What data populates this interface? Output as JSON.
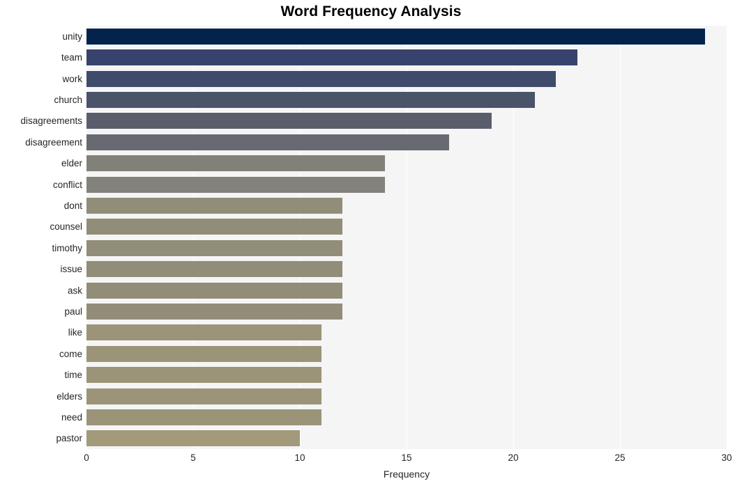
{
  "chart_data": {
    "type": "bar",
    "orientation": "horizontal",
    "title": "Word Frequency Analysis",
    "xlabel": "Frequency",
    "ylabel": "",
    "xlim": [
      0,
      30
    ],
    "xticks": [
      0,
      5,
      10,
      15,
      20,
      25,
      30
    ],
    "xtick_labels": [
      "0",
      "5",
      "10",
      "15",
      "20",
      "25",
      "30"
    ],
    "grid": "vertical-white-on-light-gray",
    "legend": "none",
    "categories": [
      "unity",
      "team",
      "work",
      "church",
      "disagreements",
      "disagreement",
      "elder",
      "conflict",
      "dont",
      "counsel",
      "timothy",
      "issue",
      "ask",
      "paul",
      "like",
      "come",
      "time",
      "elders",
      "need",
      "pastor"
    ],
    "values": [
      29,
      23,
      22,
      21,
      19,
      17,
      14,
      14,
      12,
      12,
      12,
      12,
      12,
      12,
      11,
      11,
      11,
      11,
      11,
      10
    ],
    "bar_colors": [
      "#04234c",
      "#37436c",
      "#404a6b",
      "#4b5369",
      "#5a5e6c",
      "#686a71",
      "#81817a",
      "#83827a",
      "#928d78",
      "#928d78",
      "#928d78",
      "#928d78",
      "#928d78",
      "#928d78",
      "#9b9479",
      "#9b9479",
      "#9b9479",
      "#9b9479",
      "#9b9479",
      "#a29a7b"
    ]
  },
  "colors": {
    "plot_background": "#f5f5f6",
    "figure_background": "#ffffff",
    "gridline": "#ffffff",
    "text": "#262626",
    "title": "#000000"
  }
}
